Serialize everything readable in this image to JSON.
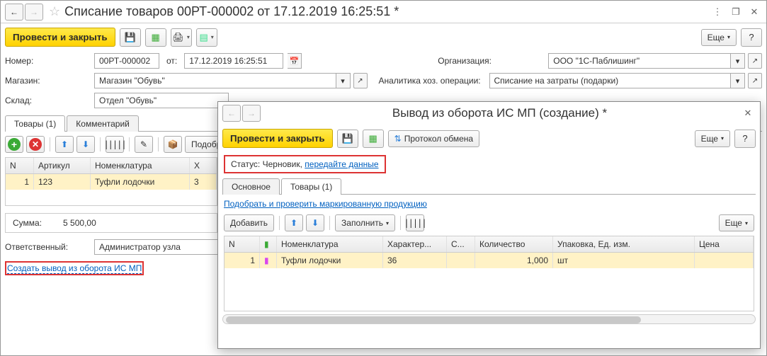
{
  "main": {
    "title": "Списание товаров 00РТ-000002 от 17.12.2019 16:25:51 *",
    "toolbar": {
      "post_close": "Провести и закрыть",
      "more": "Еще"
    },
    "form": {
      "number_label": "Номер:",
      "number_value": "00РТ-000002",
      "from_label": "от:",
      "date_value": "17.12.2019 16:25:51",
      "org_label": "Организация:",
      "org_value": "ООО \"1С-Паблишинг\"",
      "store_label": "Магазин:",
      "store_value": "Магазин \"Обувь\"",
      "analytic_label": "Аналитика хоз. операции:",
      "analytic_value": "Списание на затраты (подарки)",
      "warehouse_label": "Склад:",
      "warehouse_value": "Отдел \"Обувь\""
    },
    "tabs": {
      "goods": "Товары (1)",
      "comment": "Комментарий"
    },
    "items_tb": {
      "pick": "Подобрать"
    },
    "table": {
      "cols": {
        "n": "N",
        "art": "Артикул",
        "nom": "Номенклатура",
        "char": "Х"
      },
      "row": {
        "n": "1",
        "art": "123",
        "nom": "Туфли лодочки",
        "char": "3"
      }
    },
    "sum": {
      "label": "Сумма:",
      "value": "5 500,00"
    },
    "resp": {
      "label": "Ответственный:",
      "value": "Администратор узла"
    },
    "create_link": "Создать вывод из оборота ИС МП"
  },
  "dialog": {
    "title": "Вывод из оборота ИС МП (создание) *",
    "toolbar": {
      "post_close": "Провести и закрыть",
      "protocol": "Протокол обмена",
      "more": "Еще"
    },
    "status": {
      "label": "Статус:",
      "value": "Черновик,",
      "link": "передайте данные"
    },
    "tabs": {
      "main": "Основное",
      "goods": "Товары (1)"
    },
    "pick_link": "Подобрать и проверить маркированную продукцию",
    "add_btn": "Добавить",
    "fill_btn": "Заполнить",
    "more2": "Еще",
    "table": {
      "cols": {
        "n": "N",
        "nom": "Номенклатура",
        "char": "Характер...",
        "s": "С...",
        "qty": "Количество",
        "pack": "Упаковка, Ед. изм.",
        "price": "Цена"
      },
      "row": {
        "n": "1",
        "nom": "Туфли лодочки",
        "char": "36",
        "s": "",
        "qty": "1,000",
        "pack": "шт",
        "price": ""
      }
    }
  }
}
